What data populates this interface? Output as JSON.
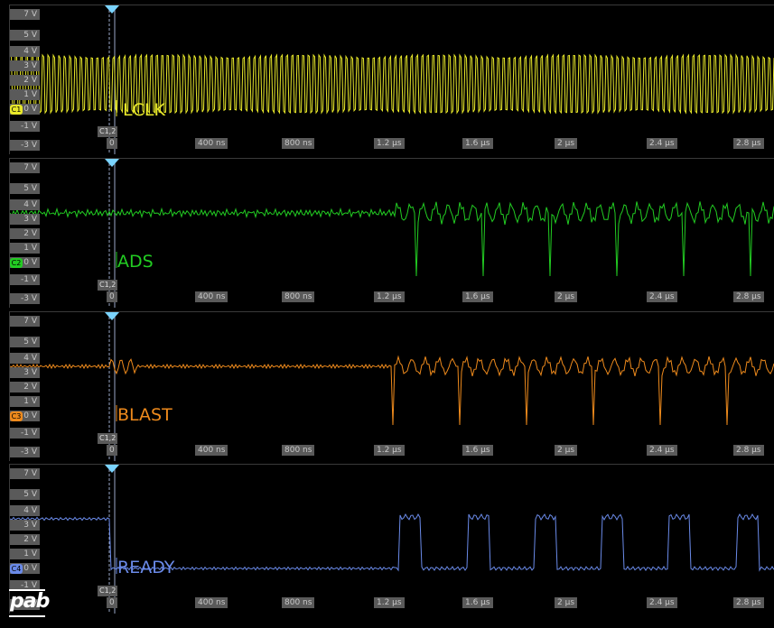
{
  "y_tick_labels": [
    "7 V",
    "5 V",
    "4 V",
    "3 V",
    "2 V",
    "1 V",
    "0 V",
    "-1 V",
    "-3 V"
  ],
  "x_tick_labels": [
    "0",
    "400 ns",
    "800 ns",
    "1.2 µs",
    "1.6 µs",
    "2 µs",
    "2.4 µs",
    "2.8 µs"
  ],
  "cursor_label": "C1,2",
  "logo_text": "pab",
  "channels": [
    {
      "id": "C1",
      "name": "LCLK",
      "color": "#e8e82a",
      "badge": "C1"
    },
    {
      "id": "C2",
      "name": "ADS",
      "color": "#22cc22",
      "badge": "C2"
    },
    {
      "id": "C3",
      "name": "BLAST",
      "color": "#ee8a1c",
      "badge": "C3"
    },
    {
      "id": "C4",
      "name": "READY",
      "color": "#6a8ae8",
      "badge": "C4"
    }
  ],
  "cursor_color": "#7ad4ff"
}
